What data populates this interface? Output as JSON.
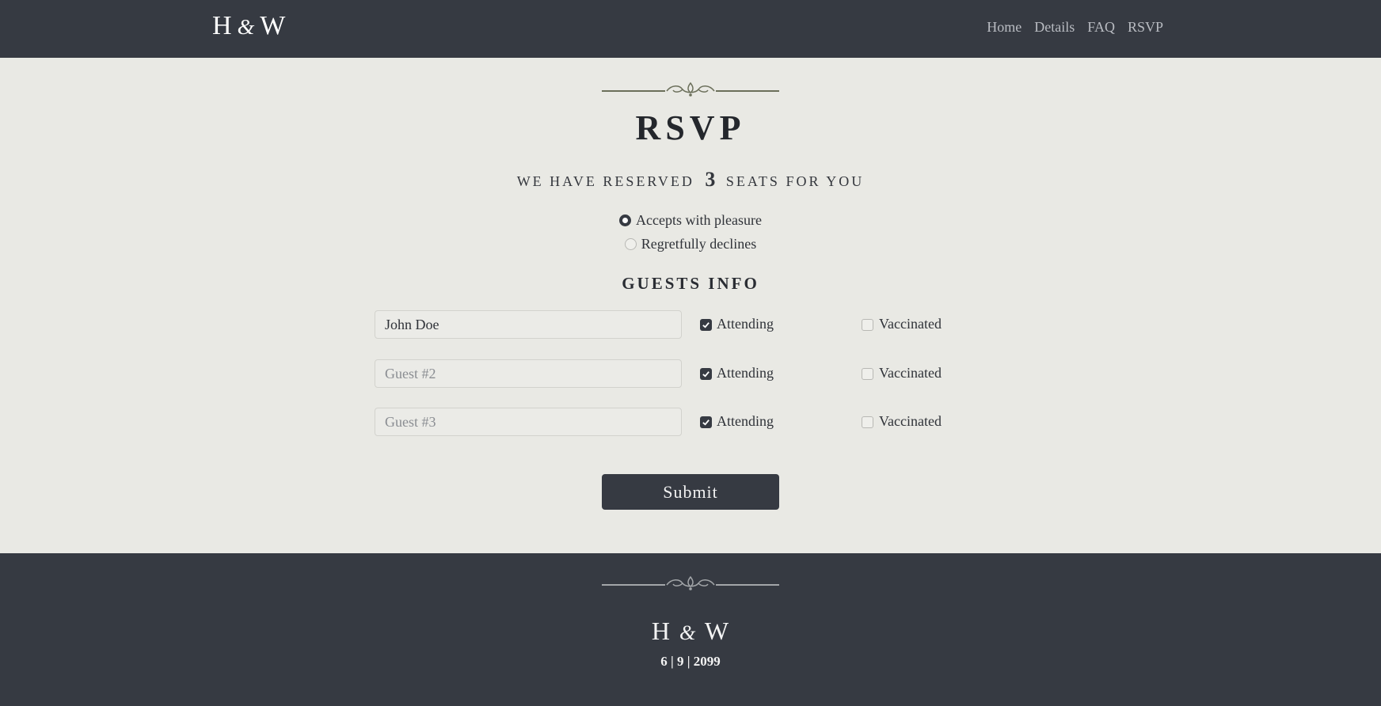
{
  "brand": {
    "initial_1": "H",
    "ampersand": "&",
    "initial_2": "W"
  },
  "nav": {
    "items": [
      "Home",
      "Details",
      "FAQ",
      "RSVP"
    ]
  },
  "main": {
    "title": "RSVP",
    "reserved_prefix": "We have reserved",
    "reserved_count": "3",
    "reserved_suffix": "seats for you",
    "options": [
      {
        "label": "Accepts with pleasure",
        "selected": true
      },
      {
        "label": "Regretfully declines",
        "selected": false
      }
    ],
    "guests_title": "GUESTS INFO",
    "guests": [
      {
        "value": "John Doe",
        "placeholder": "",
        "attending_label": "Attending",
        "attending": true,
        "vaccinated_label": "Vaccinated",
        "vaccinated": false
      },
      {
        "value": "",
        "placeholder": "Guest #2",
        "attending_label": "Attending",
        "attending": true,
        "vaccinated_label": "Vaccinated",
        "vaccinated": false
      },
      {
        "value": "",
        "placeholder": "Guest #3",
        "attending_label": "Attending",
        "attending": true,
        "vaccinated_label": "Vaccinated",
        "vaccinated": false
      }
    ],
    "submit_label": "Submit"
  },
  "footer": {
    "initial_1": "H",
    "ampersand": "&",
    "initial_2": "W",
    "date": "6 | 9 | 2099"
  },
  "colors": {
    "header_bg": "#363a42",
    "page_bg": "#e9e9e4",
    "accent": "#6b6f5a"
  }
}
